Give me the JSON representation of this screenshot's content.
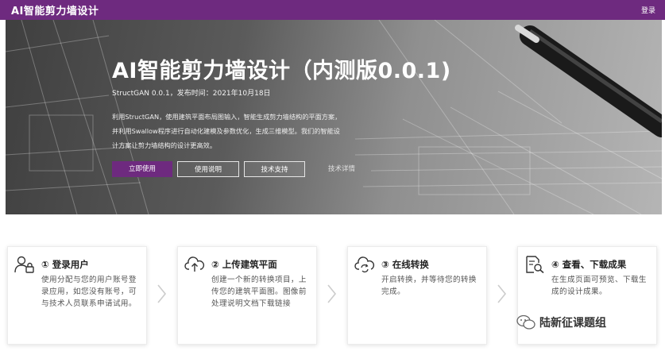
{
  "header": {
    "brand": "AI智能剪力墙设计",
    "login": "登录"
  },
  "hero": {
    "title": "AI智能剪力墙设计（内测版0.0.1)",
    "subtitle": "StructGAN 0.0.1，发布时间：2021年10月18日",
    "description": [
      "利用StructGAN，使用建筑平面布局图输入，智能生成剪力墙结构的平面方案，",
      "并利用Swallow程序进行自动化建模及参数优化，生成三维模型。我们的智能设",
      "计方案让剪力墙结构的设计更高效。"
    ],
    "buttons": {
      "start": "立即使用",
      "manual": "使用说明",
      "support": "技术支持",
      "details": "技术详情"
    }
  },
  "steps": [
    {
      "icon": "user-lock-icon",
      "title": "① 登录用户",
      "body": "使用分配与您的用户账号登录应用，如您没有账号，可与技术人员联系申请试用。"
    },
    {
      "icon": "cloud-upload-icon",
      "title": "② 上传建筑平面",
      "body": "创建一个新的转换项目，上传您的建筑平面图。图像前处理说明文档下载链接"
    },
    {
      "icon": "cloud-sync-icon",
      "title": "③ 在线转换",
      "body": "开启转换，并等待您的转换完成。"
    },
    {
      "icon": "document-search-icon",
      "title": "④ 查看、下载成果",
      "body": "在生成页面可预览、下载生成的设计成果。"
    }
  ],
  "watermark": "陆新征课题组",
  "colors": {
    "brand": "#6e2a7f",
    "hero_text": "#ffffff"
  }
}
